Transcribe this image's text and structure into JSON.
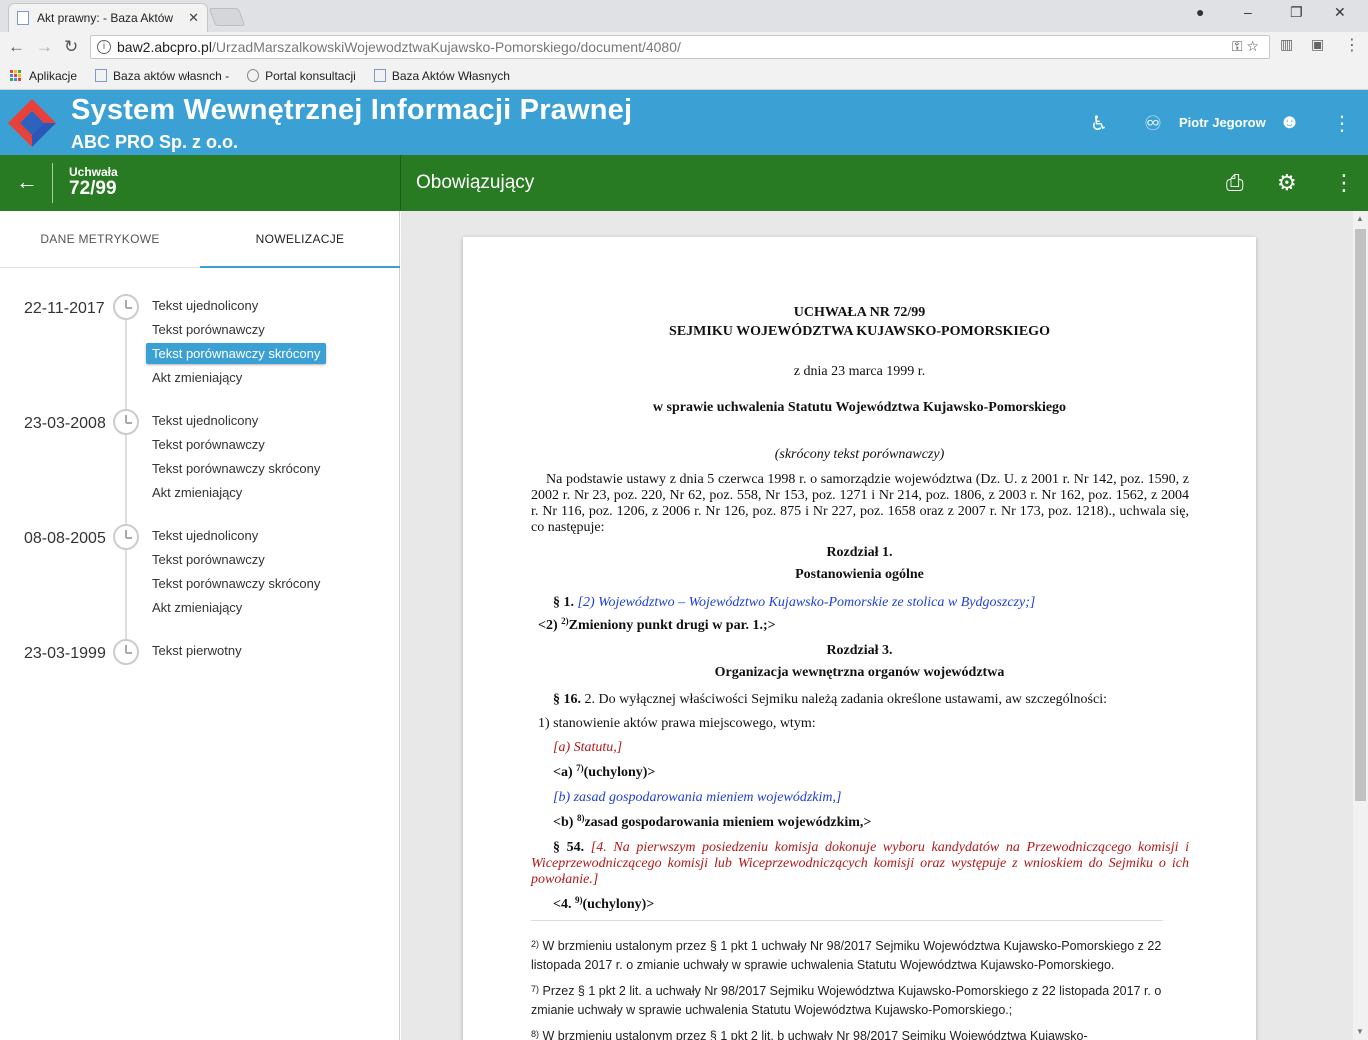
{
  "browser": {
    "tab_title": "Akt prawny: - Baza Aktów",
    "tab_close": "✕",
    "url_host": "baw2.abcpro.pl",
    "url_path": "/UrzadMarszalkowskiWojewodztwaKujawsko-Pomorskiego/document/4080/",
    "bookmarks": [
      {
        "label": "Aplikacje"
      },
      {
        "label": "Baza aktów własnch -"
      },
      {
        "label": "Portal konsultacji"
      },
      {
        "label": "Baza Aktów Własnych"
      }
    ]
  },
  "app": {
    "title": "System Wewnętrznej Informacji Prawnej",
    "subtitle": "ABC PRO Sp. z o.o.",
    "user_name": "Piotr Jegorow",
    "accent_color": "#3ba1d4",
    "green_color": "#287b22"
  },
  "subheader": {
    "doc_type": "Uchwała",
    "doc_number": "72/99",
    "status": "Obowiązujący"
  },
  "left_tabs": [
    {
      "label": "DANE METRYKOWE"
    },
    {
      "label": "NOWELIZACJE"
    }
  ],
  "timeline": [
    {
      "date": "22-11-2017",
      "items": [
        "Tekst ujednolicony",
        "Tekst porównawczy",
        "Tekst porównawczy skrócony",
        "Akt zmieniający"
      ]
    },
    {
      "date": "23-03-2008",
      "items": [
        "Tekst ujednolicony",
        "Tekst porównawczy",
        "Tekst porównawczy skrócony",
        "Akt zmieniający"
      ]
    },
    {
      "date": "08-08-2005",
      "items": [
        "Tekst ujednolicony",
        "Tekst porównawczy",
        "Tekst porównawczy skrócony",
        "Akt zmieniający"
      ]
    },
    {
      "date": "23-03-1999",
      "items": [
        "Tekst pierwotny"
      ]
    }
  ],
  "document": {
    "heading1": "UCHWAŁA NR 72/99",
    "heading2": "SEJMIKU WOJEWÓDZTWA KUJAWSKO-POMORSKIEGO",
    "date": "z dnia 23 marca 1999 r.",
    "subject": "w sprawie uchwalenia Statutu Województwa Kujawsko-Pomorskiego",
    "kind": "(skrócony tekst porównawczy)",
    "preamble": "Na podstawie ustawy z dnia 5 czerwca 1998 r. o samorządzie województwa (Dz. U. z 2001 r. Nr 142, poz. 1590, z 2002 r. Nr 23, poz. 220, Nr 62, poz. 558, Nr 153, poz. 1271 i Nr 214, poz. 1806, z 2003 r. Nr 162, poz. 1562, z 2004 r. Nr 116, poz. 1206, z 2006 r. Nr 126, poz. 875 i Nr 227, poz. 1658 oraz z 2007 r. Nr 173, poz. 1218)., uchwala się, co następuje:",
    "ch1_title": "Rozdział 1.",
    "ch1_name": "Postanowienia ogólne",
    "p1_label": "§ 1.",
    "p1_old": "[2)    Województwo – Województwo Kujawsko-Pomorskie ze stolica w Bydgoszczy;]",
    "p1_new_a": "<2) ",
    "p1_new_sup": "2)",
    "p1_new_b": "Zmieniony punkt drugi w par. 1.;>",
    "ch3_title": "Rozdział 3.",
    "ch3_name": "Organizacja wewnętrzna organów województwa",
    "p16_label": "§ 16.",
    "p16_text": "  2. Do wyłącznej właściwości Sejmiku należą zadania określone ustawami, aw szczególności:",
    "p16_pt1": "1) stanowienie aktów prawa miejscowego, wtym:",
    "p16_old_a": "[a) Statutu,]",
    "p16_new_a1": "<a) ",
    "p16_new_a_sup": "7)",
    "p16_new_a2": "(uchylony)>",
    "p16_old_b": "[b) zasad gospodarowania mieniem wojewódzkim,]",
    "p16_new_b1": "<b) ",
    "p16_new_b_sup": "8)",
    "p16_new_b2": "zasad gospodarowania mieniem wojewódzkim,>",
    "p54_label": "§ 54.",
    "p54_old": "[4. Na pierwszym posiedzeniu komisja dokonuje wyboru kandydatów na Przewodniczącego komisji i Wiceprzewodniczącego komisji lub Wiceprzewodniczących komisji oraz występuje z wnioskiem do Sejmiku o ich powołanie.]",
    "p54_new1": "<4. ",
    "p54_new_sup": "9)",
    "p54_new2": "(uchylony)>",
    "footnotes": [
      {
        "sup": "2)",
        "text": " W brzmieniu ustalonym przez § 1 pkt 1 uchwały Nr 98/2017 Sejmiku Województwa Kujawsko-Pomorskiego z 22 listopada 2017 r. o zmianie uchwały w sprawie uchwalenia Statutu Województwa Kujawsko-Pomorskiego."
      },
      {
        "sup": "7)",
        "text": " Przez § 1 pkt 2 lit. a uchwały Nr 98/2017 Sejmiku Województwa Kujawsko-Pomorskiego z 22 listopada 2017 r. o zmianie uchwały w sprawie uchwalenia Statutu Województwa Kujawsko-Pomorskiego.;"
      },
      {
        "sup": "8)",
        "text": " W brzmieniu ustalonym przez § 1 pkt 2 lit. b uchwały Nr 98/2017 Sejmiku Województwa Kujawsko-"
      }
    ]
  }
}
